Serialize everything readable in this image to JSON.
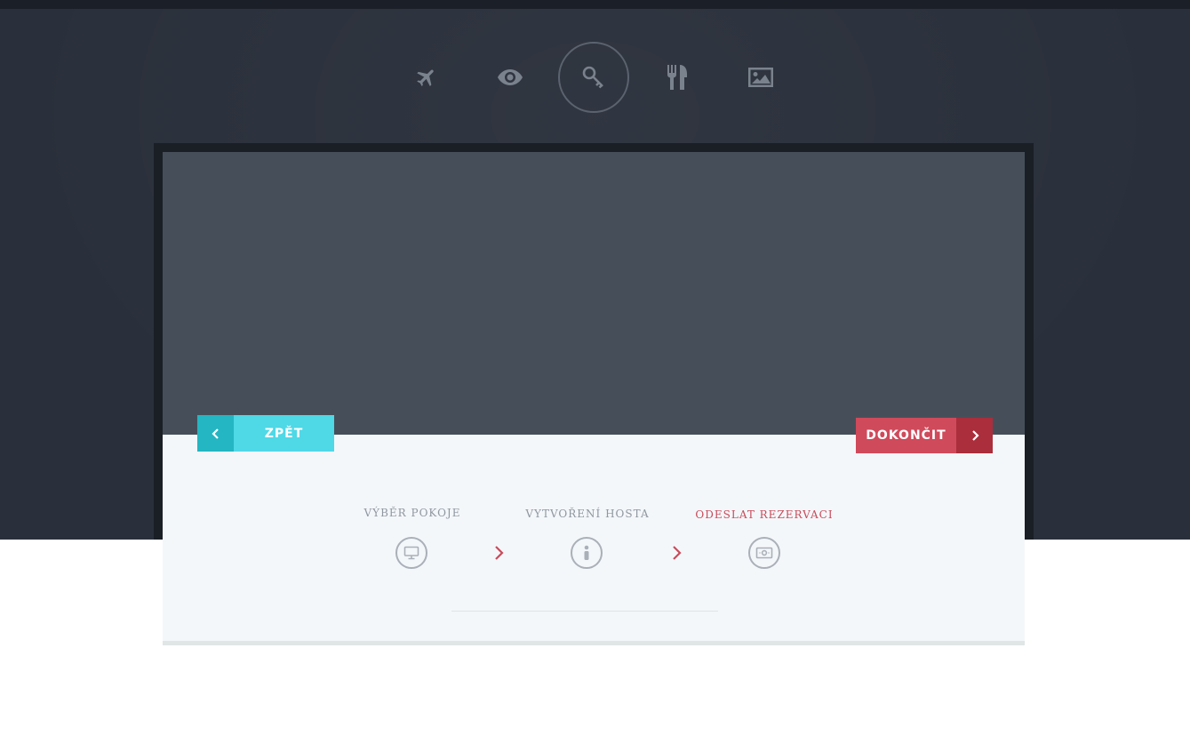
{
  "nav": {
    "items": [
      {
        "icon": "airplane-icon",
        "label": ""
      },
      {
        "icon": "eye-icon",
        "label": ""
      },
      {
        "icon": "key-icon",
        "label": "",
        "active": true
      },
      {
        "icon": "fork-knife-icon",
        "label": ""
      },
      {
        "icon": "image-icon",
        "label": ""
      }
    ]
  },
  "buttons": {
    "back_label": "ZPĚT",
    "finish_label": "DOKONČIT"
  },
  "steps": [
    {
      "label": "VÝBĚR POKOJE",
      "icon": "monitor-icon",
      "active": false
    },
    {
      "label": "VYTVOŘENÍ HOSTA",
      "icon": "person-info-icon",
      "active": false
    },
    {
      "label": "ODESLAT REZERVACI",
      "icon": "money-icon",
      "active": true
    }
  ],
  "colors": {
    "hero_bg": "#2a303b",
    "accent_cyan": "#4fd8e6",
    "accent_red": "#cf4a5b",
    "active_step": "#c94b5a"
  }
}
